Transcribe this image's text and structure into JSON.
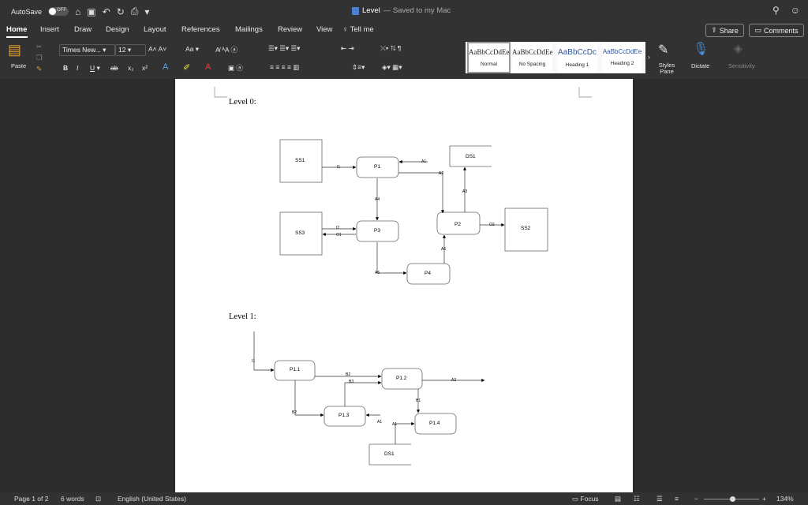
{
  "titlebar": {
    "autosave_label": "AutoSave",
    "autosave_state": "OFF",
    "doc_title": "Level",
    "saved_status": "— Saved to my Mac"
  },
  "tabs": [
    "Home",
    "Insert",
    "Draw",
    "Design",
    "Layout",
    "References",
    "Mailings",
    "Review",
    "View",
    "Tell me"
  ],
  "actions": {
    "share": "Share",
    "comments": "Comments"
  },
  "ribbon": {
    "paste": "Paste",
    "font_name": "Times New...",
    "font_size": "12",
    "styles": [
      {
        "preview": "AaBbCcDdEe",
        "name": "Normal"
      },
      {
        "preview": "AaBbCcDdEe",
        "name": "No Spacing"
      },
      {
        "preview": "AaBbCcDc",
        "name": "Heading 1"
      },
      {
        "preview": "AaBbCcDdEe",
        "name": "Heading 2"
      }
    ],
    "styles_pane": "Styles Pane",
    "dictate": "Dictate",
    "sensitivity": "Sensitivity"
  },
  "document": {
    "level0": "Level 0:",
    "level1": "Level 1:",
    "diagram0": {
      "nodes": {
        "ss1": "SS1",
        "p1": "P1",
        "ds1": "DS1",
        "ss3": "SS3",
        "p3": "P3",
        "p2": "P2",
        "ss2": "SS2",
        "p4": "P4"
      },
      "flows": {
        "i1": "I1",
        "a1": "A1",
        "a2": "A2",
        "a3": "A3",
        "a4": "A4",
        "i2": "I2",
        "o1": "O1",
        "o2": "O2",
        "a6": "A6",
        "a5": "A5"
      }
    },
    "diagram1": {
      "nodes": {
        "p11": "P1.1",
        "p12": "P1.2",
        "p13": "P1.3",
        "p14": "P1.4",
        "ds1": "DS1"
      },
      "flows": {
        "i1": "I1",
        "b2a": "B2",
        "b3": "B3",
        "a2": "A2",
        "b1": "B1",
        "b2b": "B2",
        "a1a": "A1",
        "a1b": "A1"
      }
    }
  },
  "status": {
    "page": "Page 1 of 2",
    "words": "6 words",
    "language": "English (United States)",
    "focus": "Focus",
    "zoom": "134%"
  }
}
